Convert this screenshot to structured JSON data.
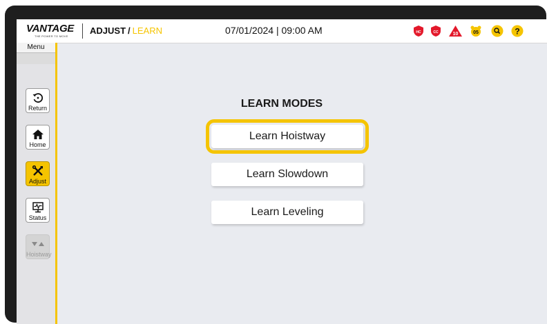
{
  "header": {
    "logo_text": "VANTAGE",
    "logo_tagline": "THE POWER TO MOVE",
    "breadcrumb_parent": "ADJUST",
    "breadcrumb_separator": "/",
    "breadcrumb_current": "LEARN",
    "datetime": "07/01/2024 | 09:00 AM",
    "status_icons": [
      {
        "name": "hc-shield-icon",
        "text": "HC",
        "color": "#e3192b"
      },
      {
        "name": "cc-shield-icon",
        "text": "CC",
        "color": "#e3192b"
      },
      {
        "name": "fault-warning-icon",
        "text": "10",
        "color": "#e3192b"
      },
      {
        "name": "alarm-clock-icon",
        "text": "05",
        "color": "#f5c400"
      },
      {
        "name": "search-icon",
        "text": "",
        "color": "#f5c400"
      },
      {
        "name": "help-icon",
        "text": "?",
        "color": "#f5c400"
      }
    ]
  },
  "sidebar": {
    "menu_label": "Menu",
    "items": [
      {
        "label": "Return",
        "icon": "return-icon",
        "state": "normal"
      },
      {
        "label": "Home",
        "icon": "home-icon",
        "state": "normal"
      },
      {
        "label": "Adjust",
        "icon": "tools-icon",
        "state": "active"
      },
      {
        "label": "Status",
        "icon": "monitor-icon",
        "state": "normal"
      },
      {
        "label": "Hoistway",
        "icon": "hoistway-arrows-icon",
        "state": "disabled"
      }
    ]
  },
  "main": {
    "title": "LEARN MODES",
    "modes": [
      {
        "label": "Learn Hoistway",
        "selected": true
      },
      {
        "label": "Learn Slowdown",
        "selected": false
      },
      {
        "label": "Learn Leveling",
        "selected": false
      }
    ]
  },
  "colors": {
    "accent": "#f5c400",
    "alarm": "#e3192b",
    "background": "#e9ebf0"
  }
}
